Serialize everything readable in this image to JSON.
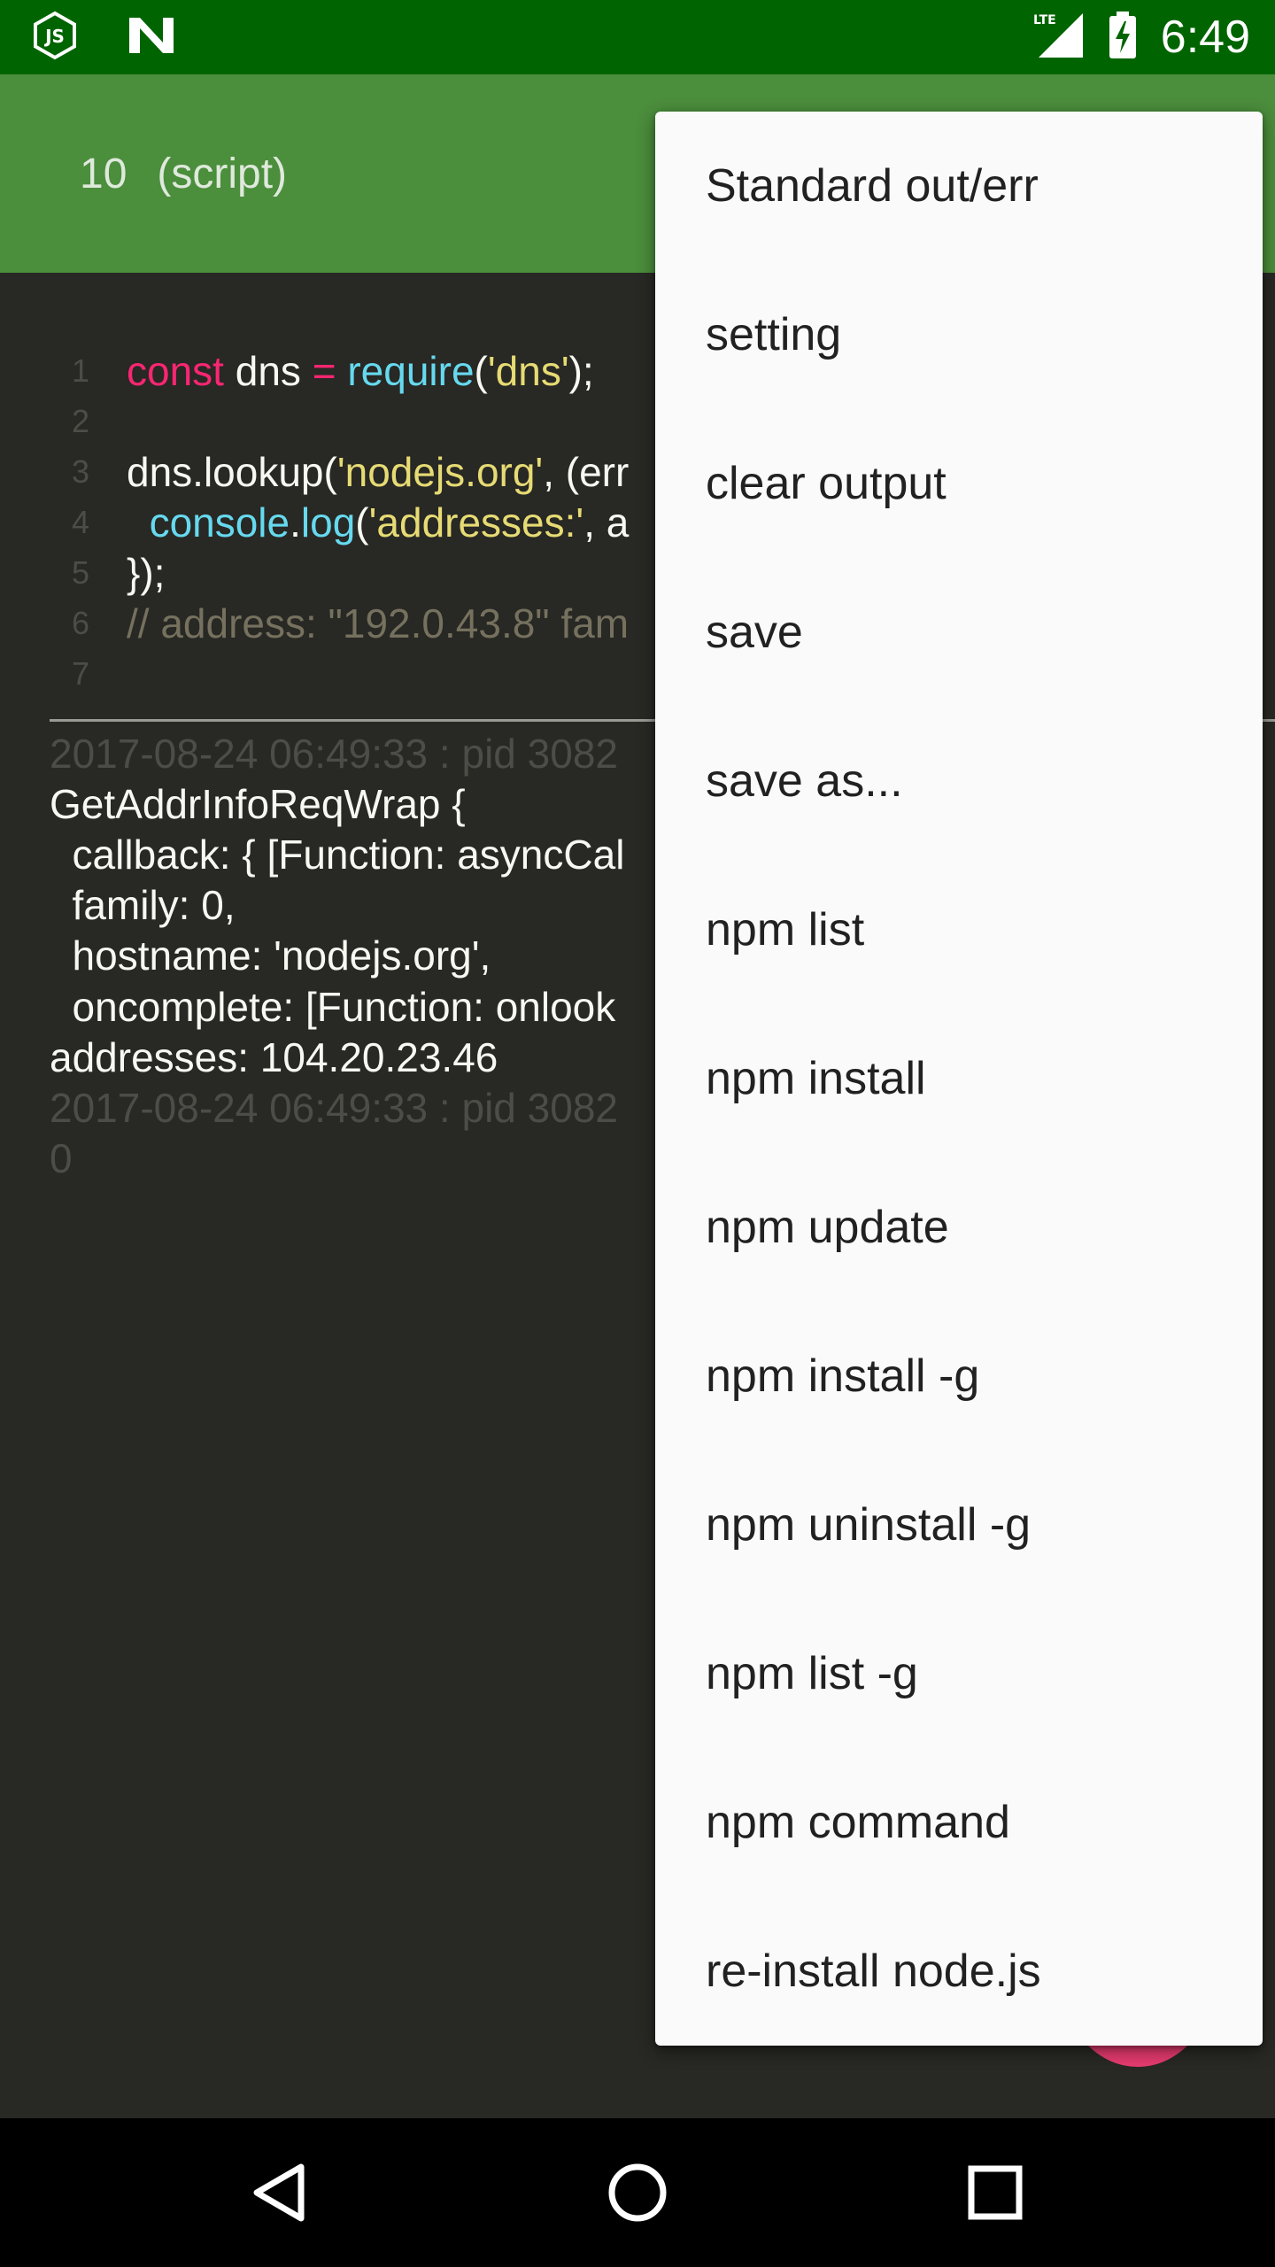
{
  "status_bar": {
    "time": "6:49",
    "network_label": "LTE",
    "icons": [
      "nodejs-js-icon",
      "n-notification-icon",
      "lte-signal-icon",
      "battery-charging-icon"
    ]
  },
  "app_bar": {
    "number": "10",
    "subtitle": "(script)"
  },
  "editor": {
    "line_numbers": [
      "1",
      "2",
      "3",
      "4",
      "5",
      "6",
      "7"
    ],
    "lines": [
      [
        {
          "t": "const",
          "c": "kw"
        },
        {
          "t": " dns ",
          "c": "pl"
        },
        {
          "t": "=",
          "c": "kw"
        },
        {
          "t": " ",
          "c": "pl"
        },
        {
          "t": "require",
          "c": "fn"
        },
        {
          "t": "(",
          "c": "pl"
        },
        {
          "t": "'dns'",
          "c": "str"
        },
        {
          "t": ");",
          "c": "pl"
        }
      ],
      [],
      [
        {
          "t": "dns.lookup(",
          "c": "pl"
        },
        {
          "t": "'nodejs.org'",
          "c": "str"
        },
        {
          "t": ", (err",
          "c": "pl"
        }
      ],
      [
        {
          "t": "  ",
          "c": "pl"
        },
        {
          "t": "console",
          "c": "fn"
        },
        {
          "t": ".",
          "c": "pl"
        },
        {
          "t": "log",
          "c": "fn"
        },
        {
          "t": "(",
          "c": "pl"
        },
        {
          "t": "'addresses:'",
          "c": "str"
        },
        {
          "t": ", a",
          "c": "pl"
        }
      ],
      [
        {
          "t": "});",
          "c": "pl"
        }
      ],
      [
        {
          "t": "// address: \"192.0.43.8\" fam",
          "c": "cm"
        }
      ],
      []
    ]
  },
  "output": {
    "lines": [
      {
        "text": "2017-08-24 06:49:33 : pid 3082",
        "dim": true
      },
      {
        "text": "GetAddrInfoReqWrap {",
        "dim": false
      },
      {
        "text": "  callback: { [Function: asyncCal",
        "dim": false
      },
      {
        "text": "  family: 0,",
        "dim": false
      },
      {
        "text": "  hostname: 'nodejs.org',",
        "dim": false
      },
      {
        "text": "  oncomplete: [Function: onlook",
        "dim": false
      },
      {
        "text": "addresses: 104.20.23.46",
        "dim": false
      },
      {
        "text": "2017-08-24 06:49:33 : pid 3082",
        "dim": true
      },
      {
        "text": "0",
        "dim": true
      }
    ]
  },
  "menu": {
    "items": [
      "Standard out/err",
      "setting",
      "clear output",
      "save",
      "save as...",
      "npm list",
      "npm install",
      "npm update",
      "npm install -g",
      "npm uninstall -g",
      "npm list -g",
      "npm command",
      "re-install node.js"
    ]
  },
  "nav_bar": {
    "buttons": [
      "back-icon",
      "home-icon",
      "recents-icon"
    ]
  },
  "colors": {
    "status_bar": "#006400",
    "app_bar": "#4b8e3c",
    "editor_bg": "#282824",
    "menu_bg": "#fafafa",
    "fab": "#e63b6f"
  }
}
